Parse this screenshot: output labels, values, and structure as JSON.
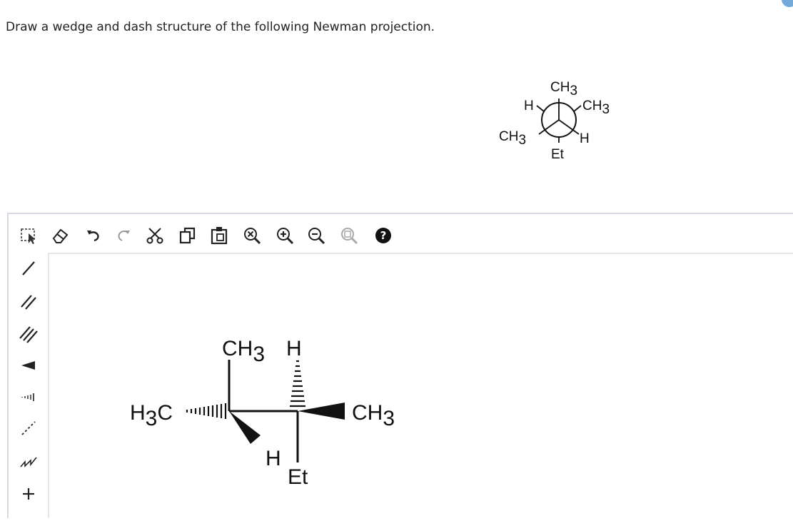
{
  "question": {
    "text": "Draw a wedge and dash structure of the following Newman projection."
  },
  "newman": {
    "front_top": "CH",
    "front_top_sub": "3",
    "front_left": "CH",
    "front_left_sub": "3",
    "front_bottom": "Et",
    "back_top_left": "H",
    "back_top_right": "CH",
    "back_top_right_sub": "3",
    "back_bottom_right": "H"
  },
  "toolbar": {
    "items": [
      {
        "name": "select",
        "icon": "lasso-select-icon"
      },
      {
        "name": "erase",
        "icon": "eraser-icon"
      },
      {
        "name": "undo",
        "icon": "undo-icon"
      },
      {
        "name": "redo",
        "icon": "redo-icon"
      },
      {
        "name": "cut",
        "icon": "scissors-icon"
      },
      {
        "name": "copy",
        "icon": "copy-icon"
      },
      {
        "name": "paste",
        "icon": "paste-icon"
      },
      {
        "name": "zoom-reset",
        "icon": "zoom-reset-icon"
      },
      {
        "name": "zoom-in",
        "icon": "zoom-in-icon"
      },
      {
        "name": "zoom-out",
        "icon": "zoom-out-icon"
      },
      {
        "name": "zoom-fit",
        "icon": "zoom-fit-icon"
      },
      {
        "name": "help",
        "icon": "help-icon"
      }
    ]
  },
  "sidebar": {
    "items": [
      {
        "name": "single-bond",
        "icon": "single-bond-icon"
      },
      {
        "name": "double-bond",
        "icon": "double-bond-icon"
      },
      {
        "name": "triple-bond",
        "icon": "triple-bond-icon"
      },
      {
        "name": "wedge-bond",
        "icon": "wedge-bond-icon"
      },
      {
        "name": "hash-bond",
        "icon": "hash-bond-icon"
      },
      {
        "name": "dash-bond",
        "icon": "dash-bond-icon"
      },
      {
        "name": "chain",
        "icon": "chain-icon"
      },
      {
        "name": "plus",
        "icon": "plus-icon"
      }
    ]
  },
  "canvas": {
    "left_c_top": "CH",
    "left_c_top_sub": "3",
    "left_c_left": "H",
    "left_c_left_sub": "3",
    "left_c_left_tail": "C",
    "left_c_down": "H",
    "right_c_top": "H",
    "right_c_right": "CH",
    "right_c_right_sub": "3",
    "right_c_bottom": "Et"
  },
  "colors": {
    "accent": "#5b9bd5",
    "border": "#d9d9e6",
    "text": "#111111"
  }
}
